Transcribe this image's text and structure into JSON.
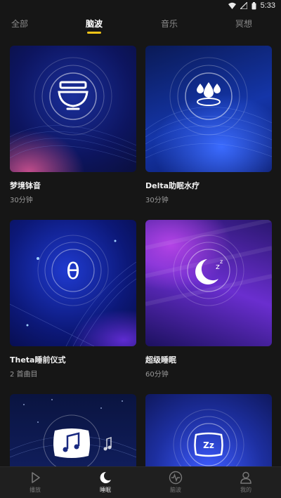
{
  "status_bar": {
    "time": "5:33"
  },
  "tabs": [
    {
      "label": "全部",
      "active": false
    },
    {
      "label": "脑波",
      "active": true
    },
    {
      "label": "音乐",
      "active": false
    },
    {
      "label": "冥想",
      "active": false
    }
  ],
  "accent_color": "#f5c518",
  "cards": [
    {
      "title": "梦境钵音",
      "subtitle": "30分钟",
      "icon": "singing-bowl-icon"
    },
    {
      "title": "Delta助眠水疗",
      "subtitle": "30分钟",
      "icon": "water-drops-icon"
    },
    {
      "title": "Theta睡前仪式",
      "subtitle": "2 首曲目",
      "icon": "theta-icon",
      "glyph": "θ"
    },
    {
      "title": "超级睡眠",
      "subtitle": "60分钟",
      "icon": "moon-zzz-icon",
      "glyph": "z"
    },
    {
      "title": "",
      "subtitle": "",
      "icon": "music-pillow-icon"
    },
    {
      "title": "",
      "subtitle": "",
      "icon": "zz-pillow-icon",
      "glyph": "Zz"
    }
  ],
  "bottom_nav": [
    {
      "label": "播放",
      "icon": "play-icon",
      "active": false
    },
    {
      "label": "睡眠",
      "icon": "moon-icon",
      "active": true
    },
    {
      "label": "脑波",
      "icon": "waveform-icon",
      "active": false
    },
    {
      "label": "我的",
      "icon": "user-icon",
      "active": false
    }
  ]
}
